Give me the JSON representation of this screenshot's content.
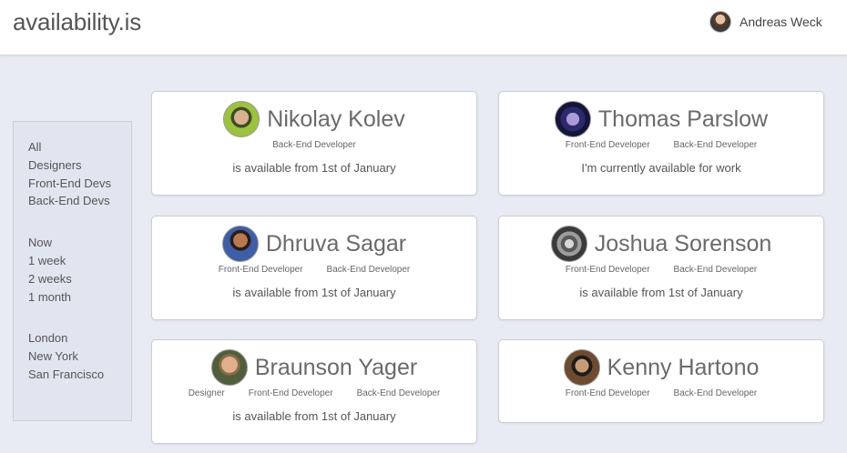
{
  "header": {
    "brand": "availability.is",
    "user_name": "Andreas Weck"
  },
  "sidebar": {
    "roles": [
      "All",
      "Designers",
      "Front-End Devs",
      "Back-End Devs"
    ],
    "timeframes": [
      "Now",
      "1 week",
      "2 weeks",
      "1 month"
    ],
    "locations": [
      "London",
      "New York",
      "San Francisco"
    ]
  },
  "people": [
    {
      "name": "Nikolay Kolev",
      "avatar_icon": "avatar-nikolay-icon",
      "roles": [
        "Back-End Developer"
      ],
      "status": "is available from 1st of January"
    },
    {
      "name": "Thomas Parslow",
      "avatar_icon": "avatar-thomas-icon",
      "roles": [
        "Front-End Developer",
        "Back-End Developer"
      ],
      "status": "I'm currently available for work"
    },
    {
      "name": "Dhruva Sagar",
      "avatar_icon": "avatar-dhruva-icon",
      "roles": [
        "Front-End Developer",
        "Back-End Developer"
      ],
      "status": "is available from 1st of January"
    },
    {
      "name": "Joshua Sorenson",
      "avatar_icon": "avatar-joshua-icon",
      "roles": [
        "Front-End Developer",
        "Back-End Developer"
      ],
      "status": "is available from 1st of January"
    },
    {
      "name": "Braunson Yager",
      "avatar_icon": "avatar-braunson-icon",
      "roles": [
        "Designer",
        "Front-End Developer",
        "Back-End Developer"
      ],
      "status": "is available from 1st of January"
    },
    {
      "name": "Kenny Hartono",
      "avatar_icon": "avatar-kenny-icon",
      "roles": [
        "Front-End Developer",
        "Back-End Developer"
      ],
      "status": ""
    }
  ]
}
